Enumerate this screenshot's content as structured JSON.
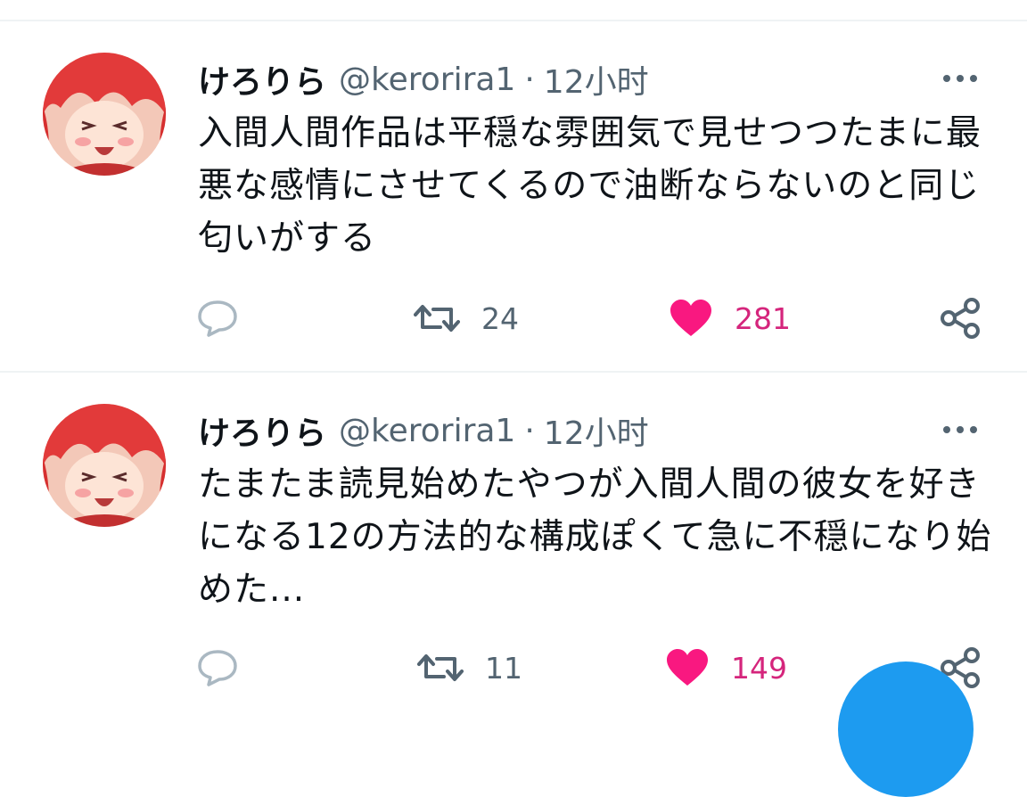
{
  "colors": {
    "like": "#f91880",
    "like_count": "#d5257c",
    "muted": "#536471",
    "fab": "#1d9bf0"
  },
  "tweets": [
    {
      "author_name": "けろりら",
      "handle": "@kerorira1",
      "separator": "·",
      "time": "12小时",
      "text": "入間人間作品は平穏な雰囲気で見せつつたまに最悪な感情にさせてくるので油断ならないのと同じ匂いがする",
      "retweet_count": "24",
      "like_count": "281",
      "icons": [
        "reply-icon",
        "retweet-icon",
        "like-icon",
        "share-icon",
        "more-icon"
      ]
    },
    {
      "author_name": "けろりら",
      "handle": "@kerorira1",
      "separator": "·",
      "time": "12小时",
      "text": "たまたま読見始めたやつが入間人間の彼女を好きになる12の方法的な構成ぽくて急に不穏になり始めた...",
      "retweet_count": "11",
      "like_count": "149",
      "icons": [
        "reply-icon",
        "retweet-icon",
        "like-icon",
        "share-icon",
        "more-icon"
      ]
    }
  ]
}
